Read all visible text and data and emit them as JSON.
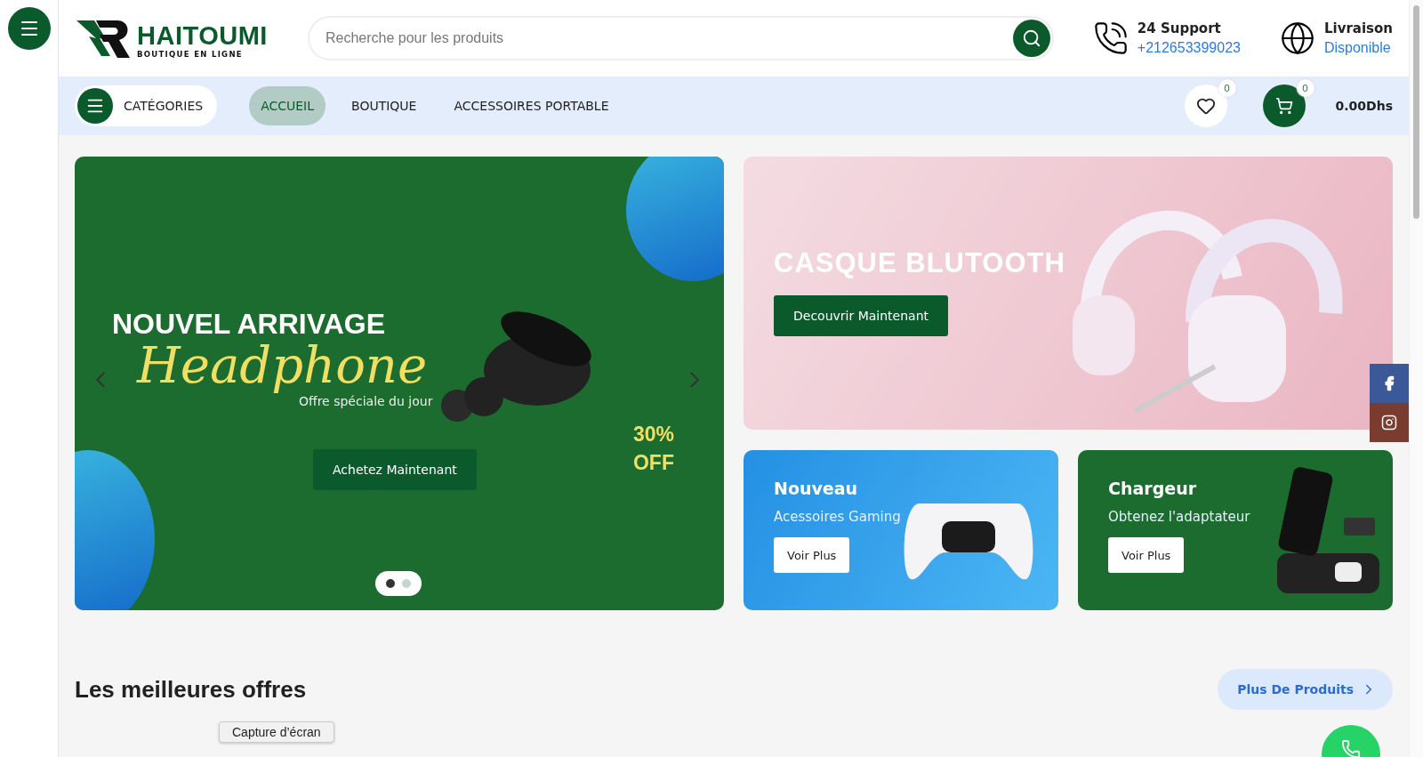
{
  "logo": {
    "name": "HAITOUMI",
    "tagline": "BOUTIQUE EN LIGNE"
  },
  "search": {
    "placeholder": "Recherche pour les produits"
  },
  "support": {
    "title": "24 Support",
    "phone": "+212653399023"
  },
  "delivery": {
    "title": "Livraison",
    "status": "Disponible"
  },
  "categories_button": "CATÉGORIES",
  "nav": [
    {
      "label": "ACCUEIL",
      "selected": true
    },
    {
      "label": "BOUTIQUE",
      "selected": false
    },
    {
      "label": "ACCESSOIRES PORTABLE",
      "selected": false
    }
  ],
  "wishlist": {
    "count": "0"
  },
  "cart": {
    "count": "0",
    "total": "0.00Dhs"
  },
  "slider": {
    "heading": "NOUVEL ARRIVAGE",
    "script": "Headphone",
    "subtitle": "Offre spéciale du jour",
    "discount": [
      "30%",
      "OFF"
    ],
    "button": "Achetez Maintenant",
    "dots": [
      {
        "selected": true
      },
      {
        "selected": false
      }
    ]
  },
  "promo_main": {
    "title": "CASQUE BLUTOOTH",
    "button": "Decouvrir Maintenant"
  },
  "promo_cards": [
    {
      "kind": "gaming",
      "title": "Nouveau",
      "subtitle": "Acessoires Gaming",
      "button": "Voir Plus"
    },
    {
      "kind": "charger",
      "title": "Chargeur",
      "subtitle": "Obtenez l'adaptateur",
      "button": "Voir Plus"
    }
  ],
  "section": {
    "title": "Les meilleures offres",
    "link": "Plus De Produits"
  },
  "tooltip": "Capture d’écran"
}
